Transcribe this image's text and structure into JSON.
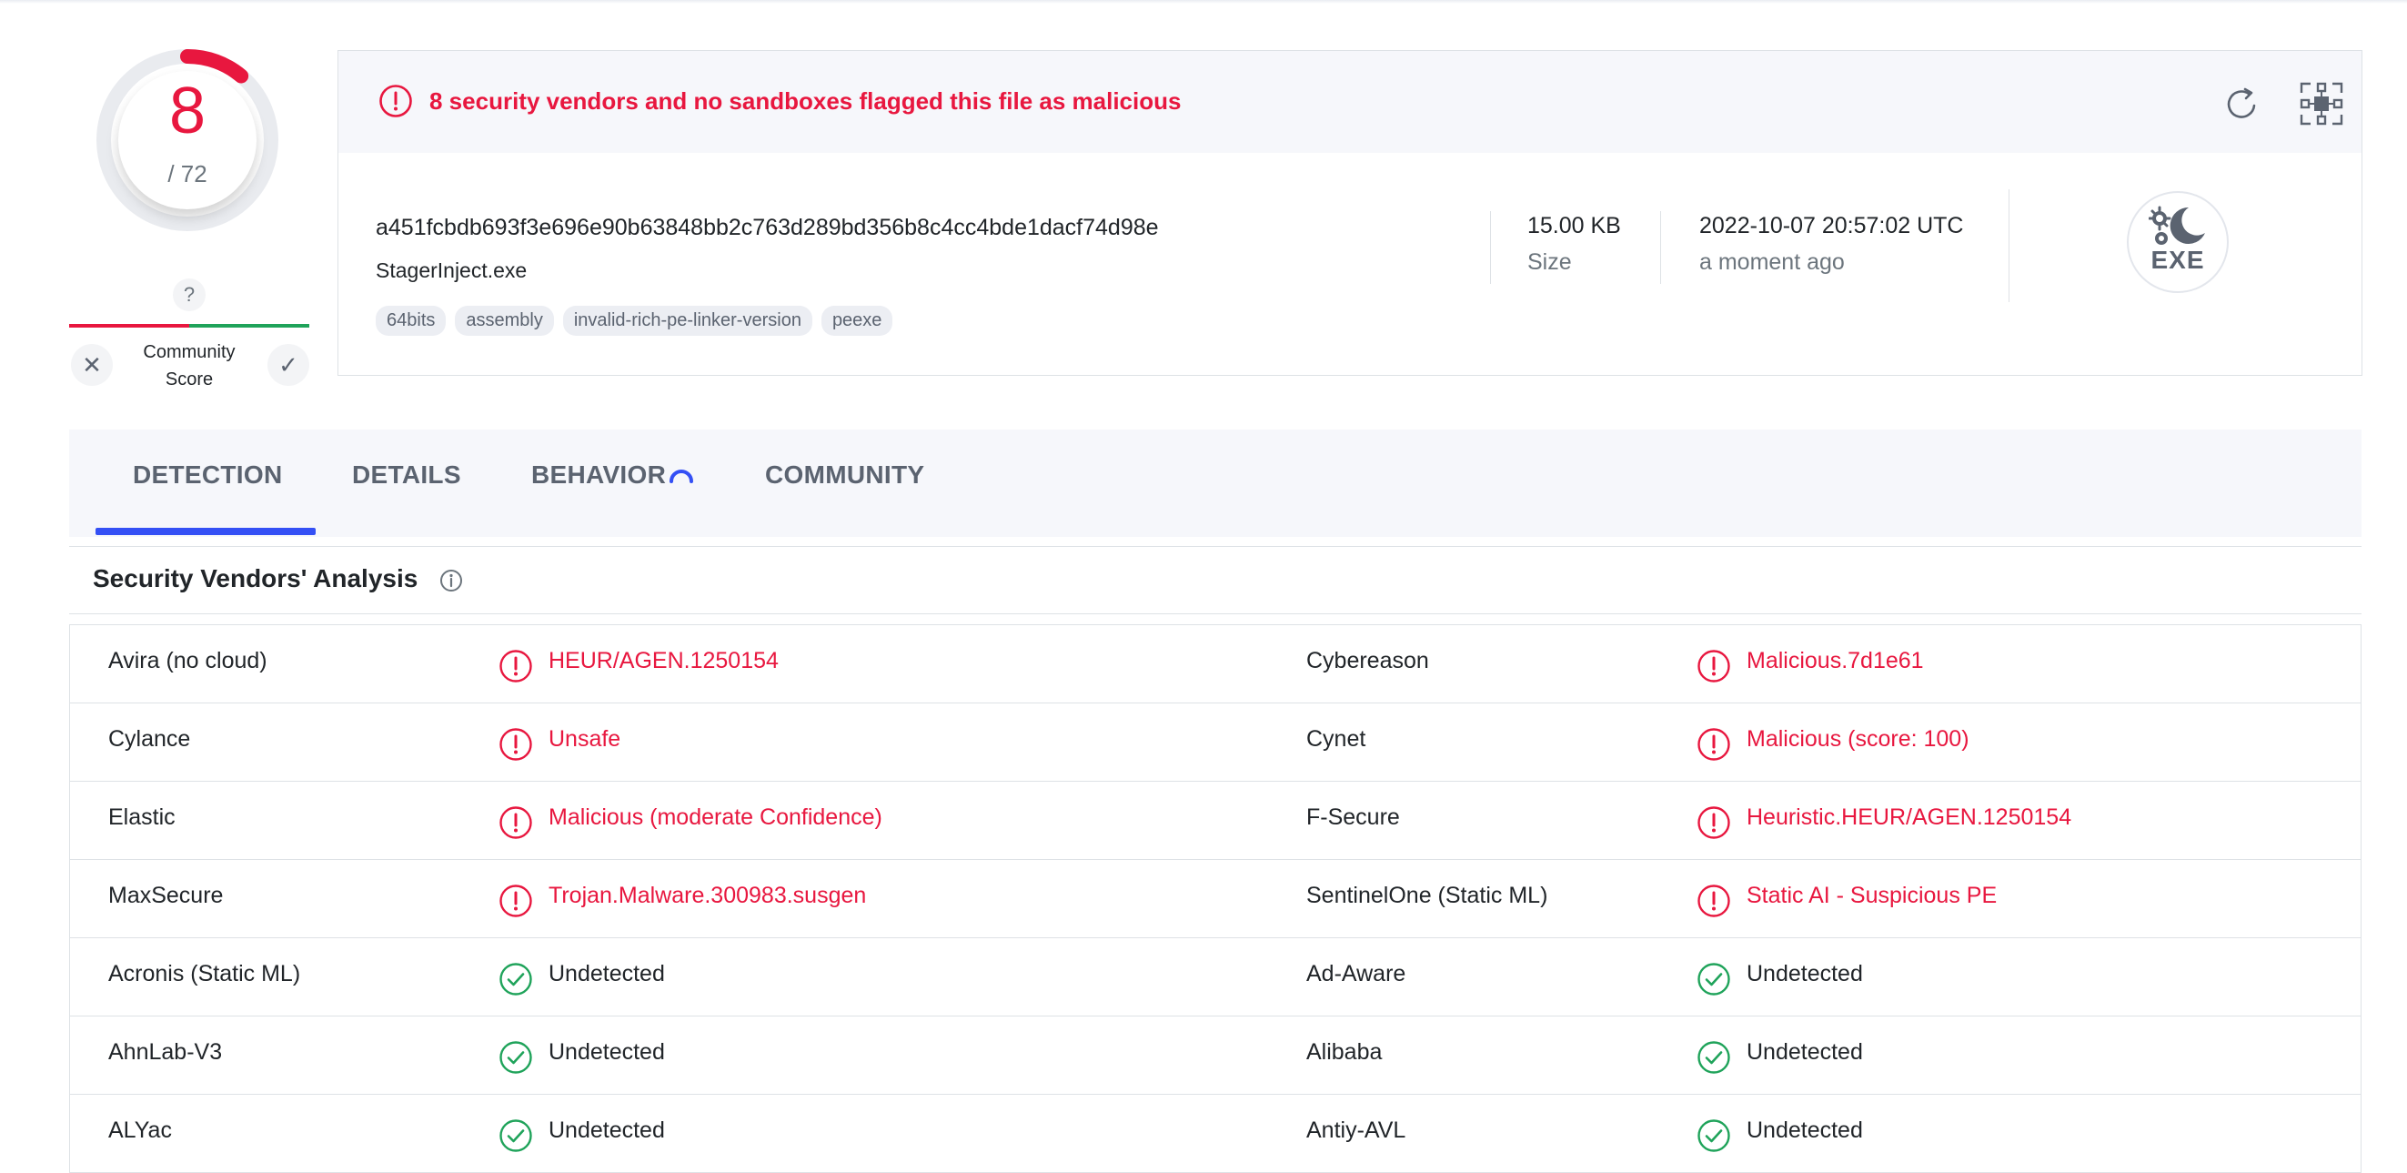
{
  "score": {
    "detections": "8",
    "total": "/ 72"
  },
  "community": {
    "unknown": "?",
    "label": "Community\nScore",
    "dislike": "✕",
    "like": "✓"
  },
  "alert": {
    "text": "8 security vendors and no sandboxes flagged this file as malicious"
  },
  "file": {
    "hash": "a451fcbdb693f3e696e90b63848bb2c763d289bd356b8c4cc4bde1dacf74d98e",
    "name": "StagerInject.exe",
    "tags": [
      "64bits",
      "assembly",
      "invalid-rich-pe-linker-version",
      "peexe"
    ],
    "size_value": "15.00 KB",
    "size_label": "Size",
    "date_value": "2022-10-07 20:57:02 UTC",
    "date_label": "a moment ago",
    "type": "EXE"
  },
  "tabs": [
    {
      "label": "DETECTION",
      "active": true
    },
    {
      "label": "DETAILS"
    },
    {
      "label": "BEHAVIOR"
    },
    {
      "label": "COMMUNITY"
    }
  ],
  "section": {
    "title": "Security Vendors' Analysis"
  },
  "vendors": [
    [
      {
        "name": "Avira (no cloud)",
        "result": "HEUR/AGEN.1250154",
        "status": "malicious"
      },
      {
        "name": "Cybereason",
        "result": "Malicious.7d1e61",
        "status": "malicious"
      }
    ],
    [
      {
        "name": "Cylance",
        "result": "Unsafe",
        "status": "malicious"
      },
      {
        "name": "Cynet",
        "result": "Malicious (score: 100)",
        "status": "malicious"
      }
    ],
    [
      {
        "name": "Elastic",
        "result": "Malicious (moderate Confidence)",
        "status": "malicious"
      },
      {
        "name": "F-Secure",
        "result": "Heuristic.HEUR/AGEN.1250154",
        "status": "malicious"
      }
    ],
    [
      {
        "name": "MaxSecure",
        "result": "Trojan.Malware.300983.susgen",
        "status": "malicious"
      },
      {
        "name": "SentinelOne (Static ML)",
        "result": "Static AI - Suspicious PE",
        "status": "malicious"
      }
    ],
    [
      {
        "name": "Acronis (Static ML)",
        "result": "Undetected",
        "status": "undetected"
      },
      {
        "name": "Ad-Aware",
        "result": "Undetected",
        "status": "undetected"
      }
    ],
    [
      {
        "name": "AhnLab-V3",
        "result": "Undetected",
        "status": "undetected"
      },
      {
        "name": "Alibaba",
        "result": "Undetected",
        "status": "undetected"
      }
    ],
    [
      {
        "name": "ALYac",
        "result": "Undetected",
        "status": "undetected"
      },
      {
        "name": "Antiy-AVL",
        "result": "Undetected",
        "status": "undetected"
      }
    ]
  ],
  "colors": {
    "malicious": "#e8173f",
    "clean": "#1fa35a",
    "accent": "#3450f5"
  }
}
